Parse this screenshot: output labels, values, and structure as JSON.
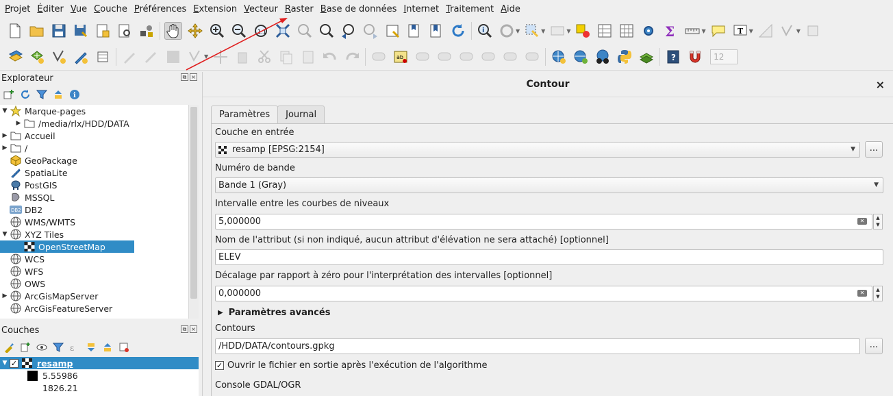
{
  "menubar": {
    "items": [
      {
        "pre": "",
        "ul": "P",
        "post": "rojet"
      },
      {
        "pre": "",
        "ul": "É",
        "post": "diter"
      },
      {
        "pre": "",
        "ul": "V",
        "post": "ue"
      },
      {
        "pre": "",
        "ul": "C",
        "post": "ouche"
      },
      {
        "pre": "",
        "ul": "P",
        "post": "références"
      },
      {
        "pre": "",
        "ul": "E",
        "post": "xtension"
      },
      {
        "pre": "",
        "ul": "V",
        "post": "ecteur"
      },
      {
        "pre": "",
        "ul": "R",
        "post": "aster"
      },
      {
        "pre": "",
        "ul": "B",
        "post": "ase de données"
      },
      {
        "pre": "",
        "ul": "I",
        "post": "nternet"
      },
      {
        "pre": "",
        "ul": "T",
        "post": "raitement"
      },
      {
        "pre": "",
        "ul": "A",
        "post": "ide"
      }
    ]
  },
  "toolbar2": {
    "font_size_value": "12"
  },
  "browser_panel": {
    "title": "Explorateur",
    "items": [
      {
        "label": "Marque-pages",
        "icon": "star-icon",
        "expand": "open",
        "indent": 0
      },
      {
        "label": "/media/rlx/HDD/DATA",
        "icon": "folder-icon",
        "expand": "closed",
        "indent": 1
      },
      {
        "label": "Accueil",
        "icon": "folder-icon",
        "expand": "closed",
        "indent": 0
      },
      {
        "label": "/",
        "icon": "folder-icon",
        "expand": "closed",
        "indent": 0
      },
      {
        "label": "GeoPackage",
        "icon": "geopackage-icon",
        "expand": "none",
        "indent": 0
      },
      {
        "label": "SpatiaLite",
        "icon": "spatialite-icon",
        "expand": "none",
        "indent": 0
      },
      {
        "label": "PostGIS",
        "icon": "postgis-icon",
        "expand": "none",
        "indent": 0
      },
      {
        "label": "MSSQL",
        "icon": "mssql-icon",
        "expand": "none",
        "indent": 0
      },
      {
        "label": "DB2",
        "icon": "db2-icon",
        "expand": "none",
        "indent": 0
      },
      {
        "label": "WMS/WMTS",
        "icon": "globe-icon",
        "expand": "none",
        "indent": 0
      },
      {
        "label": "XYZ Tiles",
        "icon": "globe-icon",
        "expand": "open",
        "indent": 0
      },
      {
        "label": "OpenStreetMap",
        "icon": "xyz-layer-icon",
        "expand": "none",
        "indent": 1,
        "selected": true
      },
      {
        "label": "WCS",
        "icon": "globe-icon",
        "expand": "none",
        "indent": 0
      },
      {
        "label": "WFS",
        "icon": "globe-icon",
        "expand": "none",
        "indent": 0
      },
      {
        "label": "OWS",
        "icon": "globe-icon",
        "expand": "none",
        "indent": 0
      },
      {
        "label": "ArcGisMapServer",
        "icon": "globe-icon",
        "expand": "closed",
        "indent": 0
      },
      {
        "label": "ArcGisFeatureServer",
        "icon": "globe-icon",
        "expand": "none",
        "indent": 0
      }
    ]
  },
  "layers_panel": {
    "title": "Couches",
    "layer_name": "resamp",
    "legend_values": [
      "5.55986",
      "1826.21"
    ]
  },
  "dialog": {
    "title": "Contour",
    "close": "×",
    "tabs": [
      "Paramètres",
      "Journal"
    ],
    "input_layer_label": "Couche en entrée",
    "input_layer_value": "resamp [EPSG:2154]",
    "band_label": "Numéro de bande",
    "band_value": "Bande 1 (Gray)",
    "interval_label": "Intervalle entre les courbes de niveaux",
    "interval_value": "5,000000",
    "attr_label": "Nom de l'attribut (si non indiqué, aucun attribut d'élévation  ne sera attaché) [optionnel]",
    "attr_value": "ELEV",
    "offset_label": "Décalage par rapport à zéro pour l'interprétation des intervalles [optionnel]",
    "offset_value": "0,000000",
    "advanced_label": "Paramètres avancés",
    "output_label": "Contours",
    "output_value": "/HDD/DATA/contours.gpkg",
    "open_output_label": "Ouvrir le fichier en sortie après l'exécution de l'algorithme",
    "console_label": "Console GDAL/OGR",
    "browse_label": "..."
  }
}
